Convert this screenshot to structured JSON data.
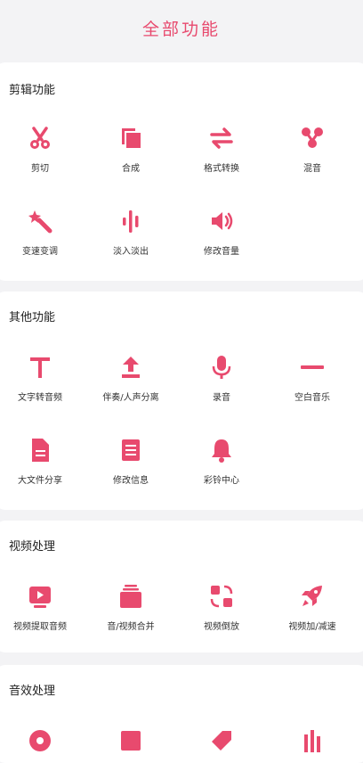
{
  "header": {
    "title": "全部功能"
  },
  "sections": [
    {
      "title": "剪辑功能",
      "items": [
        {
          "label": "剪切",
          "icon": "scissors-icon"
        },
        {
          "label": "合成",
          "icon": "copy-icon"
        },
        {
          "label": "格式转换",
          "icon": "swap-icon"
        },
        {
          "label": "混音",
          "icon": "mix-icon"
        },
        {
          "label": "变速变调",
          "icon": "magic-wand-icon"
        },
        {
          "label": "淡入淡出",
          "icon": "waveform-icon"
        },
        {
          "label": "修改音量",
          "icon": "volume-icon"
        }
      ]
    },
    {
      "title": "其他功能",
      "items": [
        {
          "label": "文字转音频",
          "icon": "text-icon"
        },
        {
          "label": "伴奏/人声分离",
          "icon": "upload-icon"
        },
        {
          "label": "录音",
          "icon": "microphone-icon"
        },
        {
          "label": "空白音乐",
          "icon": "minus-icon"
        },
        {
          "label": "大文件分享",
          "icon": "file-icon"
        },
        {
          "label": "修改信息",
          "icon": "document-icon"
        },
        {
          "label": "彩铃中心",
          "icon": "bell-icon"
        }
      ]
    },
    {
      "title": "视频处理",
      "items": [
        {
          "label": "视频提取音频",
          "icon": "video-play-icon"
        },
        {
          "label": "音/视频合并",
          "icon": "stack-icon"
        },
        {
          "label": "视频倒放",
          "icon": "reverse-icon"
        },
        {
          "label": "视频加/减速",
          "icon": "rocket-icon"
        }
      ]
    },
    {
      "title": "音效处理",
      "items": []
    }
  ],
  "colors": {
    "accent": "#e84a6e",
    "background": "#f3f3f5",
    "card": "#ffffff"
  }
}
